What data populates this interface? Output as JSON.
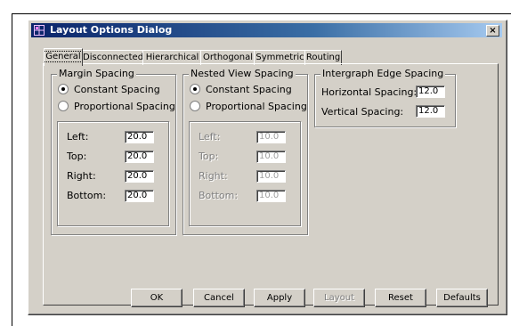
{
  "window": {
    "title": "Layout Options Dialog",
    "close_label": "×"
  },
  "tabs": [
    "General",
    "Disconnected",
    "Hierarchical",
    "Orthogonal",
    "Symmetric",
    "Routing"
  ],
  "active_tab": "General",
  "margin_spacing": {
    "title": "Margin Spacing",
    "options": [
      "Constant Spacing",
      "Proportional Spacing"
    ],
    "selected": "Constant Spacing",
    "fields": [
      {
        "label": "Left:",
        "value": "20.0"
      },
      {
        "label": "Top:",
        "value": "20.0"
      },
      {
        "label": "Right:",
        "value": "20.0"
      },
      {
        "label": "Bottom:",
        "value": "20.0"
      }
    ]
  },
  "nested_view_spacing": {
    "title": "Nested View Spacing",
    "options": [
      "Constant Spacing",
      "Proportional Spacing"
    ],
    "selected": "Constant Spacing",
    "fields": [
      {
        "label": "Left:",
        "value": "10.0"
      },
      {
        "label": "Top:",
        "value": "10.0"
      },
      {
        "label": "Right:",
        "value": "10.0"
      },
      {
        "label": "Bottom:",
        "value": "10.0"
      }
    ]
  },
  "intergraph_edge_spacing": {
    "title": "Intergraph Edge Spacing",
    "fields": [
      {
        "label": "Horizontal Spacing:",
        "value": "12.0"
      },
      {
        "label": "Vertical Spacing:",
        "value": "12.0"
      }
    ]
  },
  "buttons": {
    "ok": "OK",
    "cancel": "Cancel",
    "apply": "Apply",
    "layout": "Layout",
    "reset": "Reset",
    "defaults": "Defaults"
  }
}
